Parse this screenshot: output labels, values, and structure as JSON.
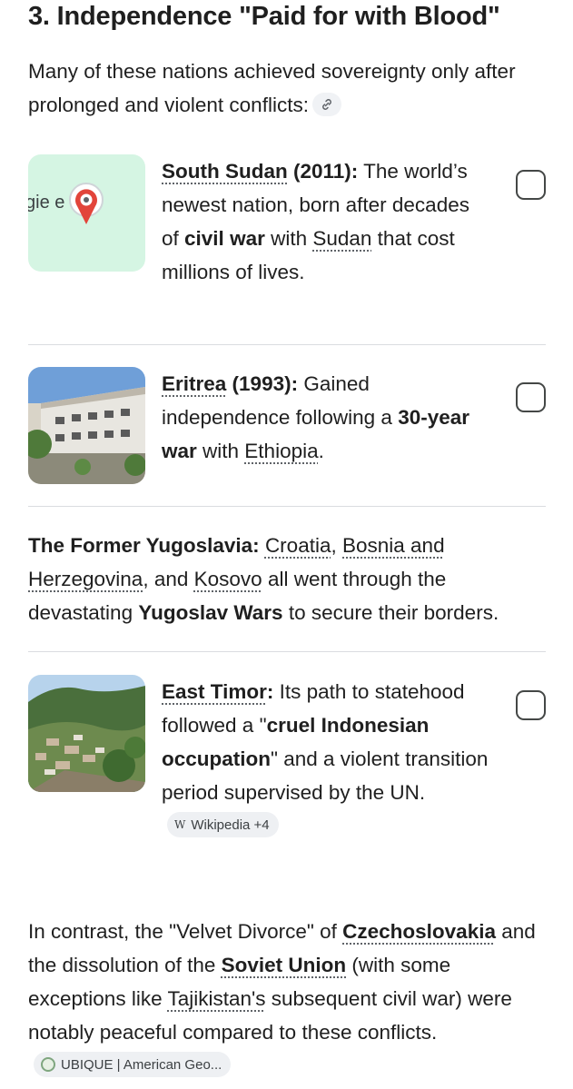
{
  "section": {
    "title": "3. Independence \"Paid for with Blood\"",
    "intro": "Many of these nations achieved sovereignty only after prolonged and violent conflicts:"
  },
  "cards": [
    {
      "name": "South Sudan",
      "year": " (2011):",
      "t1": " The world’s newest nation, born after decades of ",
      "b1": "civil war",
      "t2": " with ",
      "link2": "Sudan",
      "t3": " that cost millions of lives.",
      "map_label": "gie e"
    },
    {
      "name": "Eritrea",
      "year": " (1993):",
      "t1": " Gained independence following a ",
      "b1": "30-year war",
      "t2": " with ",
      "link2": "Ethiopia",
      "t3": "."
    },
    {
      "name": "East Timor",
      "year": ":",
      "t1": " Its path to statehood followed a \"",
      "b1": "cruel Indonesian occupation",
      "t2": "\" and a violent transition period supervised by the UN.",
      "source_chip": "Wikipedia +4",
      "source_icon": "W"
    }
  ],
  "yugoslavia": {
    "lead": "The Former Yugoslavia:",
    "l1": "Croatia",
    "s1": ", ",
    "l2": "Bosnia and Herzegovina",
    "s2": ", and ",
    "l3": "Kosovo",
    "s3": " all went through the devastating ",
    "b1": "Yugoslav Wars",
    "s4": " to secure their borders."
  },
  "contrast": {
    "t1": "In contrast, the \"Velvet Divorce\" of ",
    "l1": "Czechoslovakia",
    "t2": " and the dissolution of the ",
    "l2": "Soviet Union",
    "t3": " (with some exceptions like ",
    "l3": "Tajikistan's",
    "t4": " subsequent civil war) were notably peaceful compared to these conflicts.",
    "source_chip": "UBIQUE | American Geo..."
  },
  "colors": {
    "map_bg": "#d5f5e3",
    "map_pin": "#e2443a",
    "chip_bg": "#eef0f3",
    "divider": "#dadce0"
  }
}
